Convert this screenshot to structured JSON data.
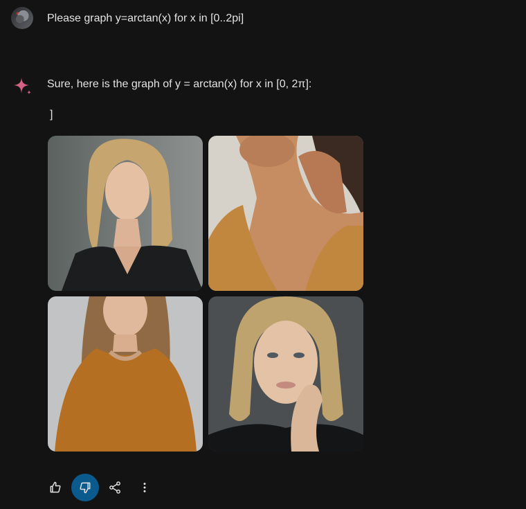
{
  "user": {
    "prompt": "Please graph y=arctan(x) for x in [0..2pi]"
  },
  "assistant": {
    "reply": "Sure, here is the graph of y = arctan(x) for x in [0, 2π]:",
    "trailing_text": "]"
  },
  "images": [
    {
      "name": "portrait-blonde-woman-black-top",
      "dominant_color": "#6f7475"
    },
    {
      "name": "woman-neck-hand-orange-top",
      "dominant_color": "#c9a680"
    },
    {
      "name": "woman-long-hair-mustard-tshirt",
      "dominant_color": "#b7b8ba"
    },
    {
      "name": "woman-blonde-bob-hand-on-face",
      "dominant_color": "#55595c"
    }
  ],
  "actions": {
    "thumbs_up": "thumbs-up-icon",
    "thumbs_down": "thumbs-down-icon",
    "share": "share-icon",
    "more": "more-vertical-icon"
  },
  "colors": {
    "background": "#131314",
    "text": "#e3e3e3",
    "active_button": "#0b5a8d",
    "spark": "#d96570"
  }
}
